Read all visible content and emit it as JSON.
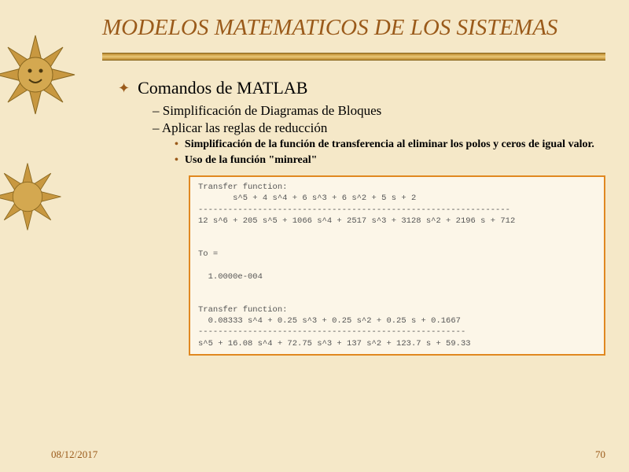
{
  "title": "MODELOS MATEMATICOS DE LOS SISTEMAS",
  "bullets": {
    "level1": "Comandos de MATLAB",
    "level2": [
      "Simplificación de Diagramas de Bloques",
      "Aplicar las reglas de reducción"
    ],
    "level3": [
      "Simplificación de la función de transferencia al eliminar los polos y ceros de igual valor.",
      "Uso de la función \"minreal\""
    ]
  },
  "code": "Transfer function:\n       s^5 + 4 s^4 + 6 s^3 + 6 s^2 + 5 s + 2\n---------------------------------------------------------------\n12 s^6 + 205 s^5 + 1066 s^4 + 2517 s^3 + 3128 s^2 + 2196 s + 712\n\n\nTo =\n\n  1.0000e-004\n\n\nTransfer function:\n  0.08333 s^4 + 0.25 s^3 + 0.25 s^2 + 0.25 s + 0.1667\n------------------------------------------------------\ns^5 + 16.08 s^4 + 72.75 s^3 + 137 s^2 + 123.7 s + 59.33",
  "footer": {
    "date": "08/12/2017",
    "page": "70"
  }
}
